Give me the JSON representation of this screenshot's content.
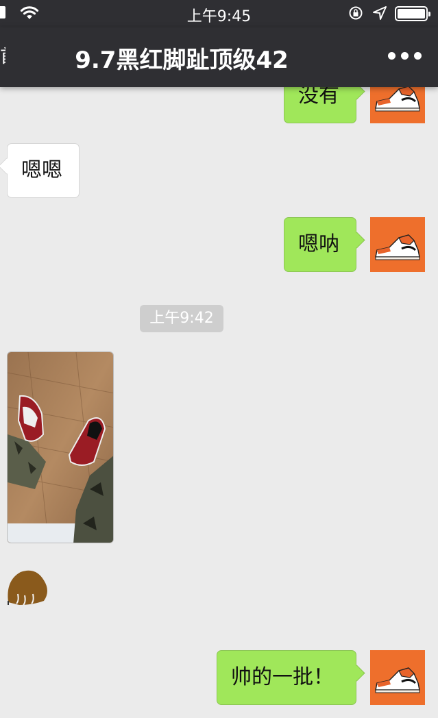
{
  "status_bar": {
    "time": "上午9:45",
    "icons": [
      "signal-icon",
      "wifi-icon",
      "rotation-lock-icon",
      "location-arrow-icon",
      "battery-icon"
    ]
  },
  "nav": {
    "back_label": "首",
    "title": "9.7黑红脚趾顶级42",
    "more_icon": "more-dots-icon"
  },
  "messages": [
    {
      "side": "out",
      "text": "没有"
    },
    {
      "side": "in",
      "text": "嗯嗯"
    },
    {
      "side": "out",
      "text": "嗯呐"
    },
    {
      "timestamp": "上午9:42"
    },
    {
      "side": "in",
      "type": "image",
      "description_icon": "photo-shoes-icon"
    },
    {
      "side": "in",
      "type": "sticker",
      "description_icon": "sticker-icon"
    },
    {
      "side": "out",
      "text": "帅的一批！"
    }
  ],
  "colors": {
    "bar": "#2f2f33",
    "background": "#ebebeb",
    "outgoing_bubble": "#a0e75a",
    "incoming_bubble": "#ffffff",
    "avatar_bg": "#ee6f2c"
  }
}
